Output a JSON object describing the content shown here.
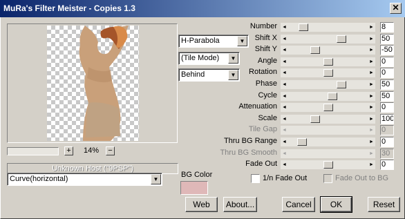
{
  "window": {
    "title": "MuRa's Filter Meister - Copies 1.3",
    "close_label": "✕"
  },
  "preview": {
    "zoom_minus": "−",
    "zoom_plus": "+",
    "zoom_value": "14%"
  },
  "status": "Unknown Host (\"9PSP\")",
  "dropdowns": {
    "mode": "H-Parabola",
    "tile": "(Tile Mode)",
    "position": "Behind",
    "curve": "Curve(horizontal)"
  },
  "bg_color": {
    "label": "BG Color",
    "value": "#dfb8b8"
  },
  "params": [
    {
      "label": "Number",
      "value": "8",
      "level": 0.15,
      "enabled": true
    },
    {
      "label": "Shift X",
      "value": "50",
      "level": 0.69,
      "enabled": true
    },
    {
      "label": "Shift Y",
      "value": "-50",
      "level": 0.32,
      "enabled": true
    },
    {
      "label": "Angle",
      "value": "0",
      "level": 0.5,
      "enabled": true
    },
    {
      "label": "Rotation",
      "value": "0",
      "level": 0.5,
      "enabled": true
    },
    {
      "label": "Phase",
      "value": "50",
      "level": 0.69,
      "enabled": true
    },
    {
      "label": "Cycle",
      "value": "50",
      "level": 0.56,
      "enabled": true
    },
    {
      "label": "Attenuation",
      "value": "0",
      "level": 0.5,
      "enabled": true
    },
    {
      "label": "Scale",
      "value": "100",
      "level": 0.32,
      "enabled": true
    },
    {
      "label": "Tile Gap",
      "value": "0",
      "level": null,
      "enabled": false
    },
    {
      "label": "Thru BG Range",
      "value": "0",
      "level": 0.13,
      "enabled": true
    },
    {
      "label": "Thru BG Smooth",
      "value": "30",
      "level": null,
      "enabled": false
    },
    {
      "label": "Fade Out",
      "value": "0",
      "level": 0.5,
      "enabled": true
    }
  ],
  "checkboxes": [
    {
      "label": "1/n Fade Out",
      "checked": false,
      "enabled": true
    },
    {
      "label": "Fade Out to BG",
      "checked": false,
      "enabled": false
    }
  ],
  "buttons": {
    "web": "Web",
    "about": "About...",
    "cancel": "Cancel",
    "ok": "OK",
    "reset": "Reset"
  }
}
